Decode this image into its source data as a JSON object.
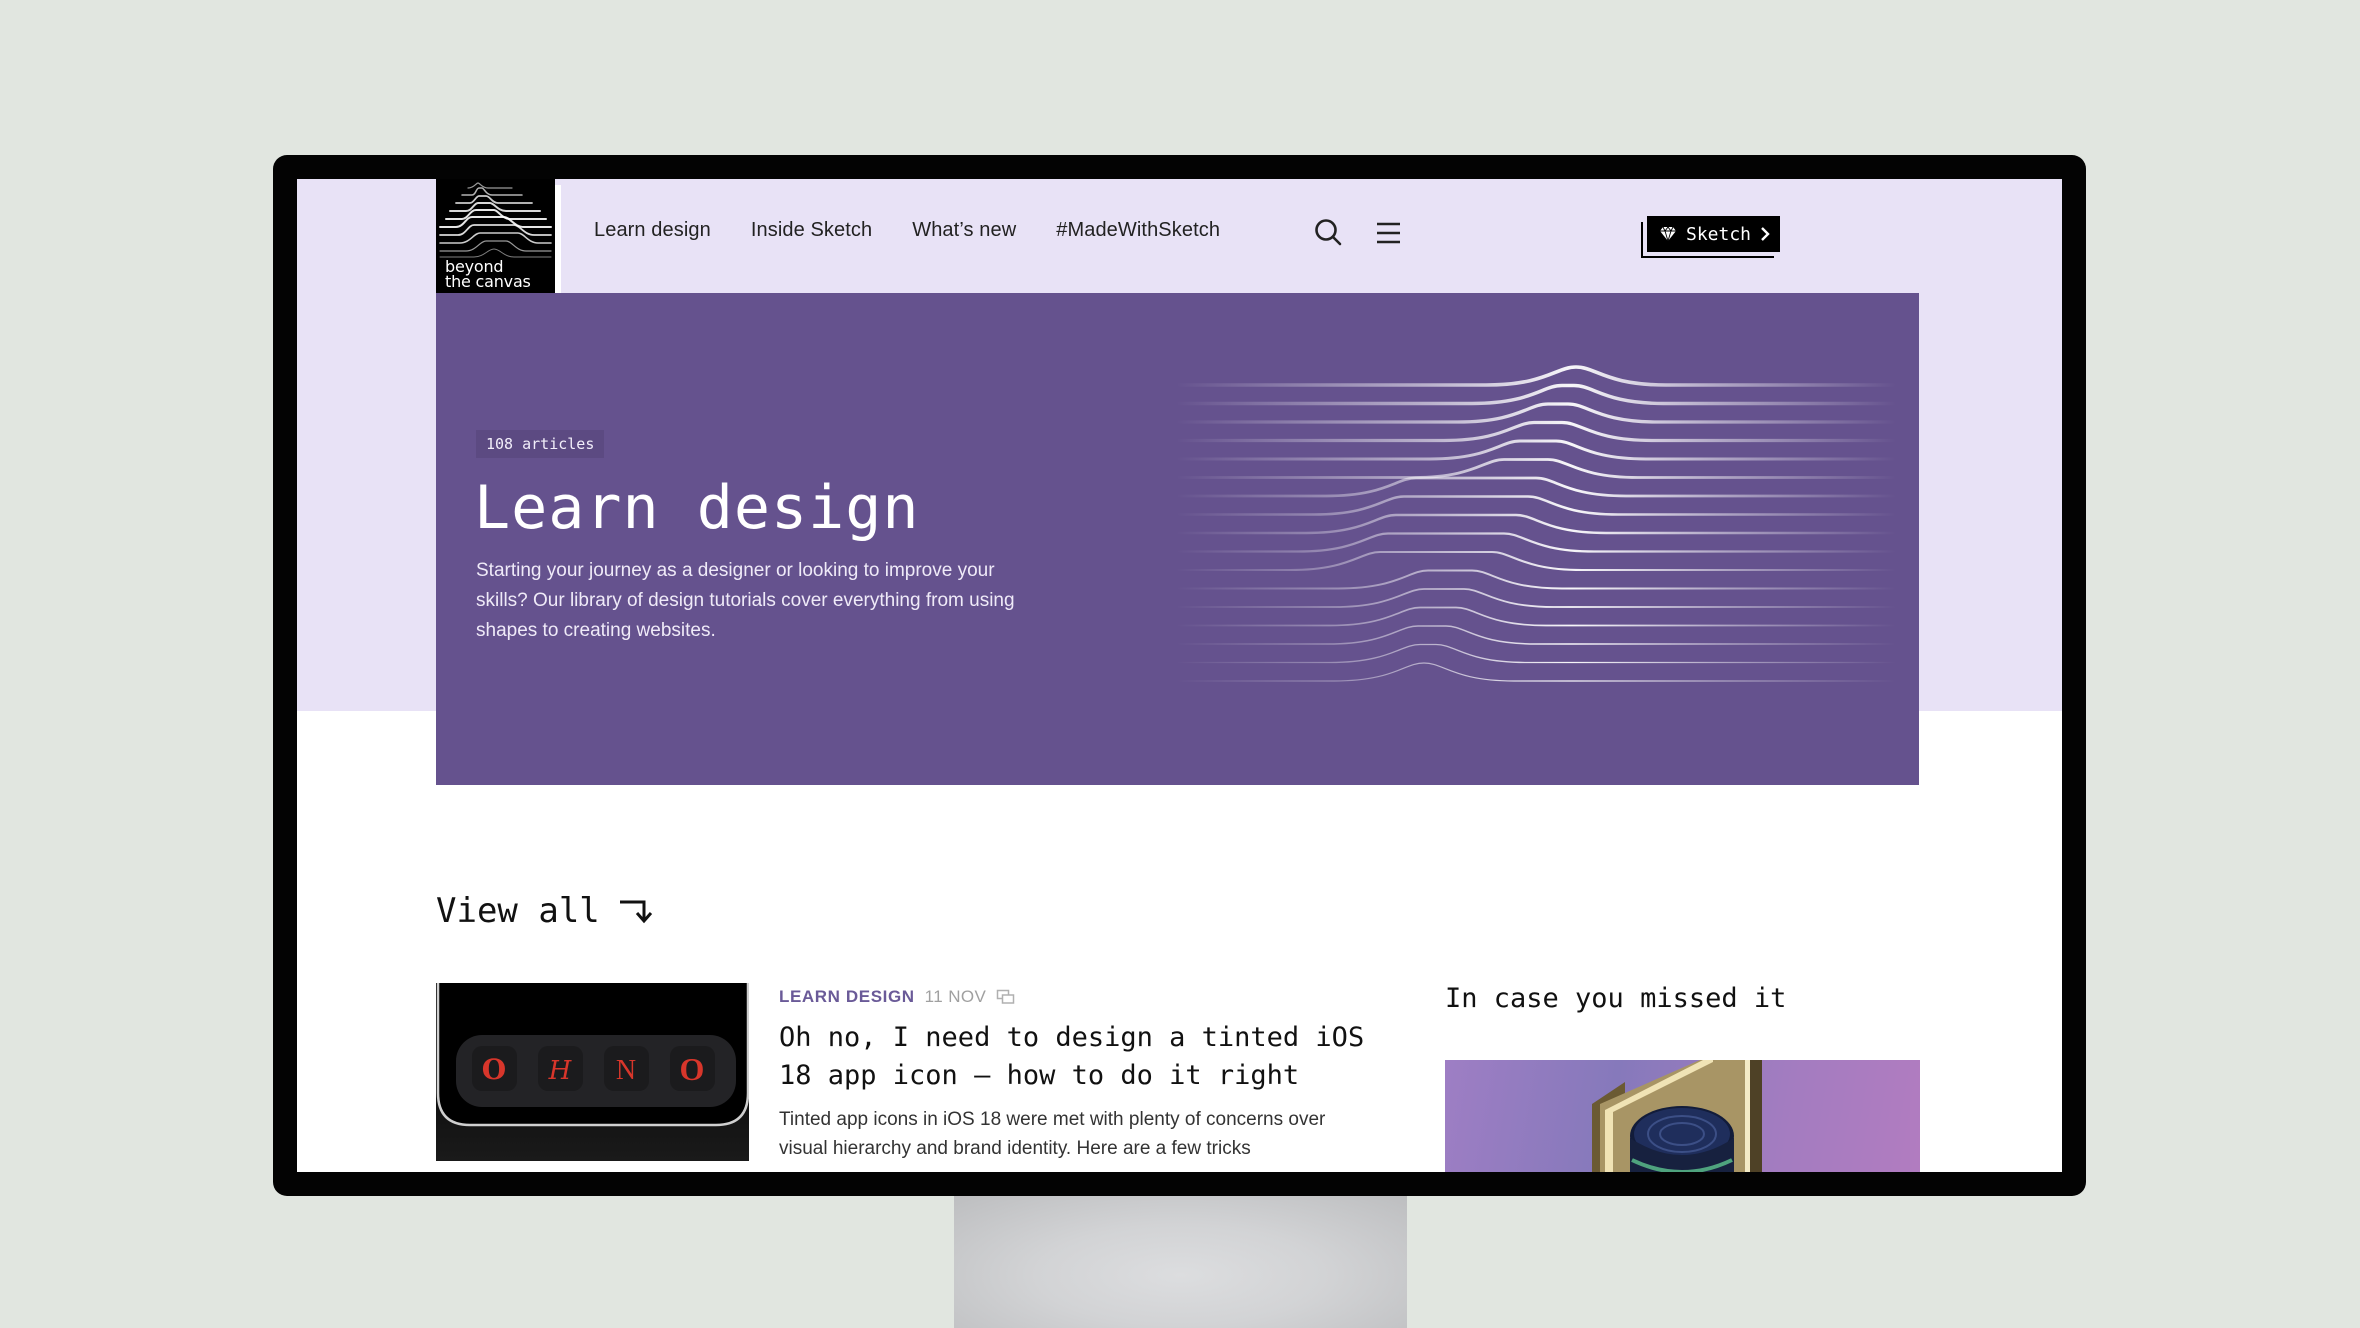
{
  "site": {
    "logo_line1": "beyond",
    "logo_line2": "the canvas"
  },
  "nav": {
    "items": [
      {
        "label": "Learn design"
      },
      {
        "label": "Inside Sketch"
      },
      {
        "label": "What’s new"
      },
      {
        "label": "#MadeWithSketch"
      }
    ],
    "sketch_button": {
      "label": "Sketch",
      "icon": "diamond-icon",
      "trailing_icon": "chevron-right-icon"
    },
    "search_icon": "search-icon",
    "menu_icon": "hamburger-menu-icon"
  },
  "hero": {
    "badge": "108 articles",
    "title": "Learn design",
    "description": "Starting your journey as a designer or looking to improve your skills? Our library of design tutorials cover everything from using shapes to creating websites.",
    "background_color": "#65528e"
  },
  "section": {
    "view_all_label": "View all",
    "view_all_icon": "arrow-turn-down-icon"
  },
  "featured_article": {
    "category": "LEARN DESIGN",
    "date": "11 NOV",
    "meta_icon": "gallery-icon",
    "title": "Oh no, I need to design a tinted iOS 18 app icon — how to do it right",
    "excerpt": "Tinted app icons in iOS 18 were met with plenty of concerns over visual hierarchy and brand identity. Here are a few tricks",
    "thumbnail_letters": [
      "O",
      "H",
      "N",
      "O"
    ],
    "accent_color": "#6a5a98"
  },
  "sidebar": {
    "title": "In case you missed it"
  },
  "colors": {
    "lavender": "#e8e2f6",
    "purple": "#65528e",
    "backdrop": "#e1e6e0"
  }
}
